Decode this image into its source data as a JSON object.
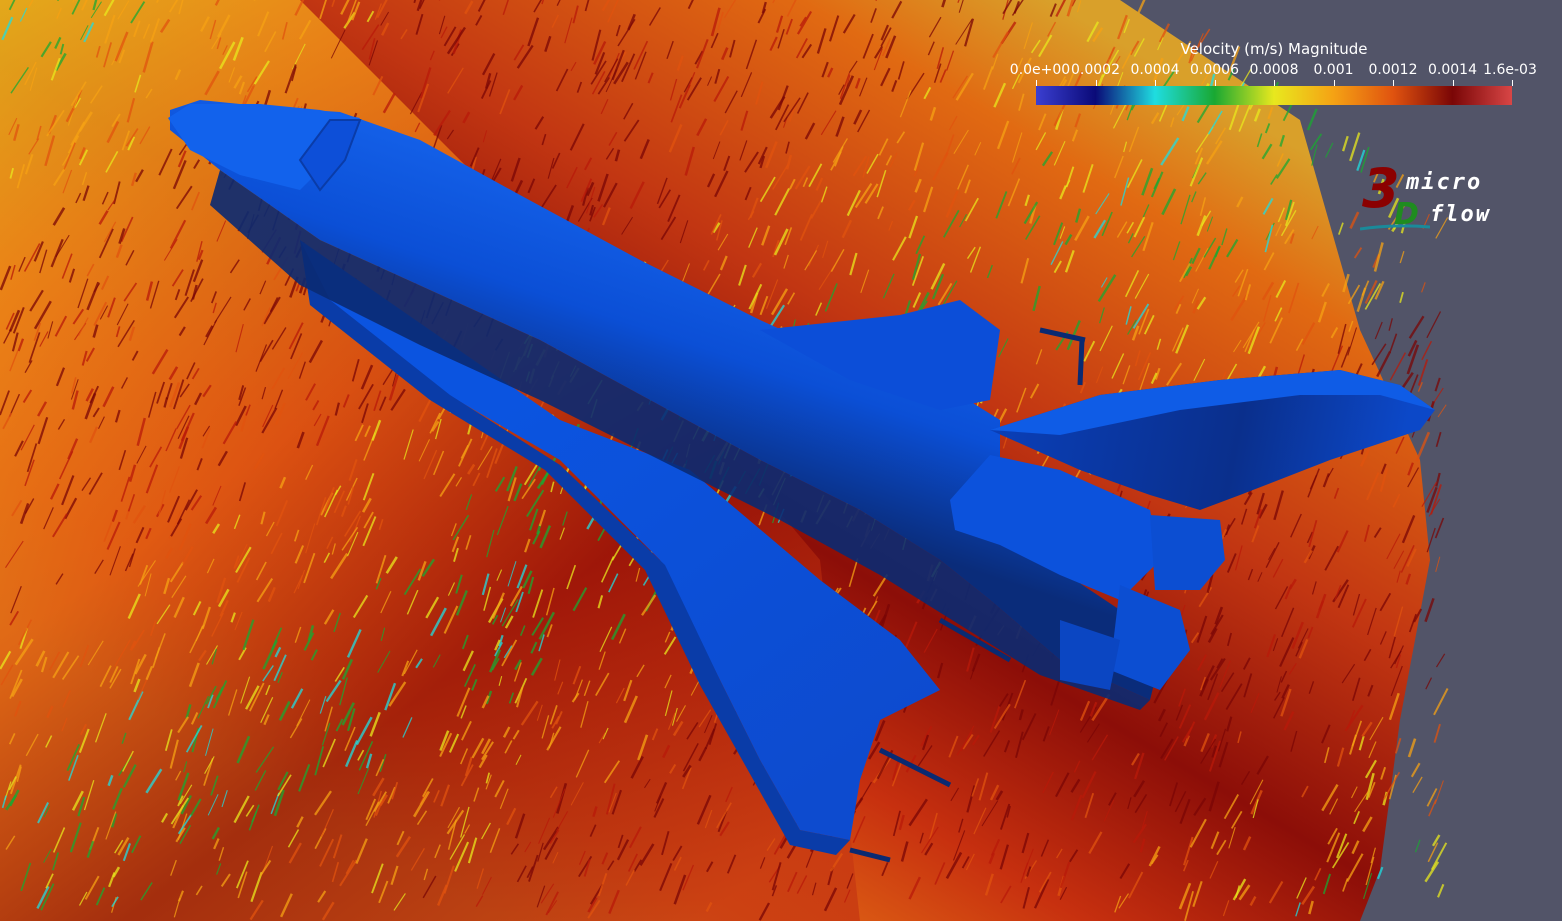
{
  "colorbar": {
    "title": "Velocity (m/s) Magnitude",
    "labels": [
      "0.0e+00",
      "0.0002",
      "0.0004",
      "0.0006",
      "0.0008",
      "0.001",
      "0.0012",
      "0.0014",
      "1.6e-03"
    ],
    "colormap": [
      "#3b3fd1",
      "#0a0a78",
      "#1fdde0",
      "#19a832",
      "#e8e81e",
      "#f5a214",
      "#e0530f",
      "#7a0606",
      "#d84646"
    ]
  },
  "logo": {
    "digit": "3",
    "letter": "D",
    "word_top": "micro",
    "word_bottom": "flow"
  },
  "model": {
    "color": "#0b4fd6"
  },
  "flow_field": {
    "colors": [
      "#e8e81e",
      "#f5a214",
      "#e0530f",
      "#b81a0a",
      "#7a0606",
      "#19a832",
      "#1fdde0",
      "#d84646"
    ]
  }
}
